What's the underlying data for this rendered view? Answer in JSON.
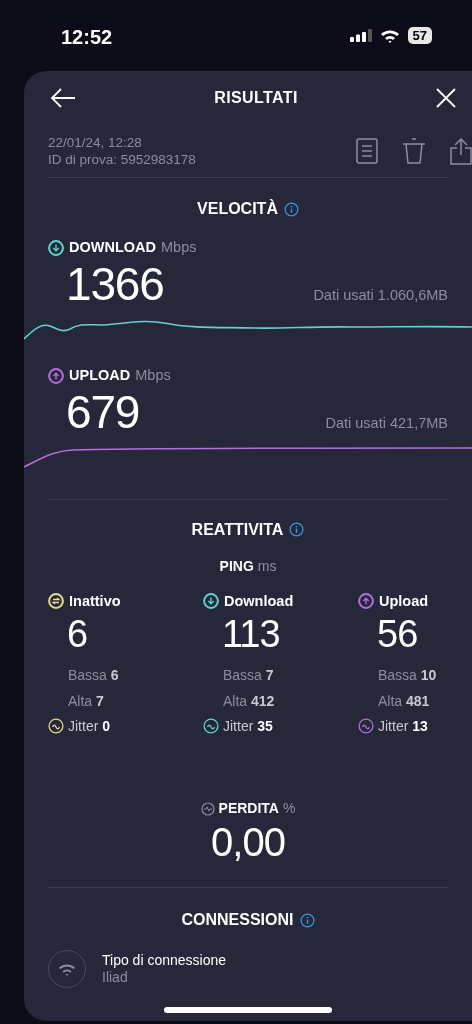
{
  "status_bar": {
    "time": "12:52",
    "battery": "57"
  },
  "header": {
    "title": "RISULTATI",
    "date": "22/01/24, 12:28",
    "test_id": "ID di prova: 5952983178"
  },
  "speed": {
    "title": "VELOCITÀ",
    "items": [
      {
        "kind": "download",
        "label": "DOWNLOAD",
        "unit": "Mbps",
        "value": "1366",
        "data_used": "Dati usati 1.060,6MB",
        "color": "#5fd3d0"
      },
      {
        "kind": "upload",
        "label": "UPLOAD",
        "unit": "Mbps",
        "value": "679",
        "data_used": "Dati usati 421,7MB",
        "color": "#b36ee0"
      }
    ]
  },
  "responsiveness": {
    "title": "REATTIVITA",
    "ping_label": "PING",
    "ping_unit": "ms",
    "columns": [
      {
        "kind": "idle",
        "label": "Inattivo",
        "value": "6",
        "low_label": "Bassa",
        "low": "6",
        "high_label": "Alta",
        "high": "7",
        "jitter_label": "Jitter",
        "jitter": "0",
        "color": "#e8dc8a"
      },
      {
        "kind": "download",
        "label": "Download",
        "value": "113",
        "low_label": "Bassa",
        "low": "7",
        "high_label": "Alta",
        "high": "412",
        "jitter_label": "Jitter",
        "jitter": "35",
        "color": "#5fd3d0"
      },
      {
        "kind": "upload",
        "label": "Upload",
        "value": "56",
        "low_label": "Bassa",
        "low": "10",
        "high_label": "Alta",
        "high": "481",
        "jitter_label": "Jitter",
        "jitter": "13",
        "color": "#b36ee0"
      }
    ]
  },
  "loss": {
    "label": "PERDITA",
    "unit": "%",
    "value": "0,00"
  },
  "connections": {
    "title": "CONNESSIONI",
    "items": [
      {
        "label": "Tipo di connessione",
        "value": "Iliad"
      }
    ]
  }
}
